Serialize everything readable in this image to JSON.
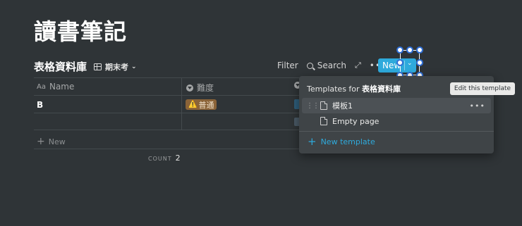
{
  "page": {
    "title": "讀書筆記"
  },
  "database": {
    "title": "表格資料庫",
    "view_label": "期末考",
    "view_chevron": "⌄"
  },
  "toolbar": {
    "filter_label": "Filter",
    "search_label": "Search",
    "expand_glyph": "⤢",
    "more_glyph": "•••",
    "new_label": "New",
    "new_arrow": "⌄"
  },
  "table": {
    "columns": [
      {
        "icon": "Aa",
        "label": "Name"
      },
      {
        "icon": "select-icon",
        "label": "難度"
      }
    ],
    "rows": [
      {
        "name": "B",
        "difficulty": {
          "prefix": "⚠️",
          "label": "普通"
        }
      },
      {
        "name": "",
        "difficulty": null
      }
    ],
    "add_row_label": "New",
    "count_label": "COUNT",
    "count_value": "2"
  },
  "templates_menu": {
    "title_prefix": "Templates for ",
    "title_db": "表格資料庫",
    "items": [
      {
        "label": "模板1",
        "more": "•••"
      },
      {
        "label": "Empty page"
      }
    ],
    "new_template_label": "New template"
  },
  "tooltip": {
    "text": "Edit this template"
  },
  "colors": {
    "background": "#2f3437",
    "accent": "#2eaadc",
    "tag_bg": "#8a6338",
    "menu_bg": "#3f4447"
  }
}
